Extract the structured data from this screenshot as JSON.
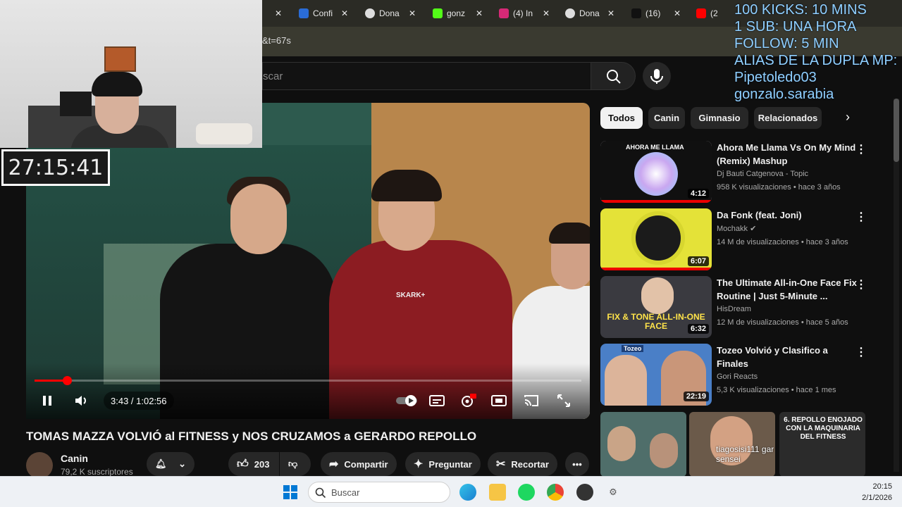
{
  "browser": {
    "tabs": [
      {
        "label": "Confi",
        "icon": "paypal-icon",
        "color": "#2a6cd6"
      },
      {
        "label": "Dona",
        "icon": "edge-icon",
        "color": "#dddddd"
      },
      {
        "label": "gonz",
        "icon": "kick-icon",
        "color": "#53fc18"
      },
      {
        "label": "(4) In",
        "icon": "instagram-icon",
        "color": "#d62976"
      },
      {
        "label": "Dona",
        "icon": "edge-icon",
        "color": "#dddddd"
      },
      {
        "label": "(16)",
        "icon": "tiktok-icon",
        "color": "#111111"
      },
      {
        "label": "(2",
        "icon": "youtube-icon",
        "color": "#ff0000"
      }
    ],
    "url": "&t=67s"
  },
  "youtube": {
    "search_placeholder": "scar",
    "filter_chips": [
      "Todos",
      "Canin",
      "Gimnasio",
      "Relacionados"
    ],
    "player": {
      "time": "3:43 / 1:02:56",
      "progress": 0.059
    },
    "video": {
      "title": "TOMAS MAZZA VOLVIÓ al FITNESS y NOS CRUZAMOS a GERARDO REPOLLO",
      "shirt_text": "SKARK+",
      "channel": "Canin",
      "subscribers": "79,2 K suscriptores",
      "likes": "203",
      "share": "Compartir",
      "ask": "Preguntar",
      "clip": "Recortar"
    },
    "recommendations": [
      {
        "title": "Ahora Me Llama Vs On My Mind (Remix) Mashup",
        "channel": "Dj Bauti Catgenova - Topic",
        "meta": "958 K visualizaciones • hace 3 años",
        "duration": "4:12",
        "thumb_color": "#f2e9f4",
        "thumb_text": "AHORA ME LLAMA"
      },
      {
        "title": "Da Fonk (feat. Joni)",
        "channel": "Mochakk",
        "meta": "14 M de visualizaciones • hace 3 años",
        "duration": "6:07",
        "thumb_color": "#e4e238",
        "thumb_text": ""
      },
      {
        "title": "The Ultimate All-in-One Face Fix Routine | Just 5-Minute ...",
        "channel": "HisDream",
        "meta": "12 M de visualizaciones • hace 5 años",
        "duration": "6:32",
        "thumb_color": "#3a3a40",
        "thumb_text": "FIX & TONE ALL-IN-ONE FACE"
      },
      {
        "title": "Tozeo Volvió y Clasifico a Finales",
        "channel": "Gori Reacts",
        "meta": "5,3 K visualizaciones • hace 1 mes",
        "duration": "22:19",
        "thumb_color": "#4a7fc7",
        "thumb_text": "Tozeo"
      }
    ],
    "shorts": [
      {
        "color": "#4f6e6a",
        "text": ""
      },
      {
        "color": "#6b5a4a",
        "text": "tiagosisi111 gar sensei"
      },
      {
        "color": "#2b2b2b",
        "text": "6. REPOLLO ENOJADO CON LA MAQUINARIA DEL FITNESS"
      }
    ]
  },
  "overlays": {
    "timer": "27:15:41",
    "goals": [
      "100 KICKS: 10 MINS",
      "1 SUB: UNA HORA",
      "FOLLOW: 5 MIN",
      "ALIAS DE LA DUPLA MP:",
      "Pipetoledo03",
      "gonzalo.sarabia"
    ]
  },
  "taskbar": {
    "search_placeholder": "Buscar",
    "time": "20:15",
    "date": "2/1/2026"
  }
}
